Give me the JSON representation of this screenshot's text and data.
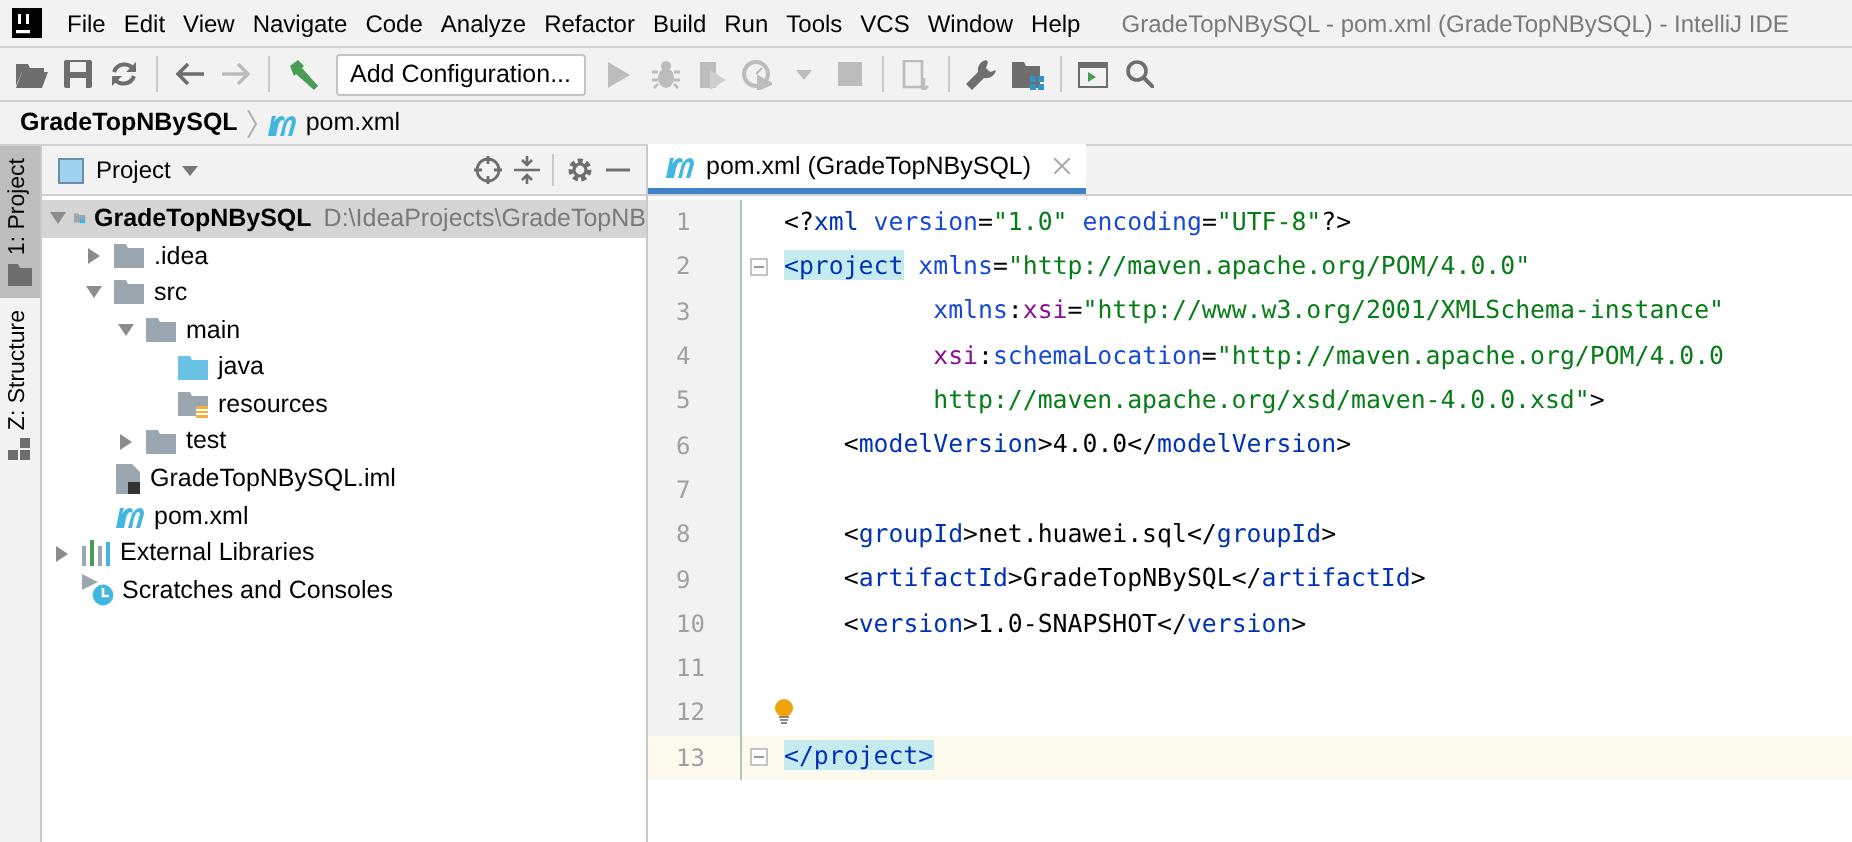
{
  "menu_bar": {
    "items": [
      "File",
      "Edit",
      "View",
      "Navigate",
      "Code",
      "Analyze",
      "Refactor",
      "Build",
      "Run",
      "Tools",
      "VCS",
      "Window",
      "Help"
    ],
    "window_title": "GradeTopNBySQL - pom.xml (GradeTopNBySQL) - IntelliJ IDE"
  },
  "toolbar": [
    {
      "kind": "open",
      "disabled": false
    },
    {
      "kind": "save",
      "disabled": false
    },
    {
      "kind": "sync",
      "disabled": false
    },
    {
      "kind": "sep"
    },
    {
      "kind": "back",
      "disabled": false
    },
    {
      "kind": "forward",
      "disabled": true
    },
    {
      "kind": "sep"
    },
    {
      "kind": "build",
      "disabled": false
    },
    {
      "kind": "config",
      "label": "Add Configuration..."
    },
    {
      "kind": "run",
      "disabled": true
    },
    {
      "kind": "debug",
      "disabled": true
    },
    {
      "kind": "coverage",
      "disabled": true
    },
    {
      "kind": "profile",
      "disabled": true
    },
    {
      "kind": "caret",
      "disabled": true
    },
    {
      "kind": "stop",
      "disabled": true
    },
    {
      "kind": "sep"
    },
    {
      "kind": "deploy",
      "disabled": true
    },
    {
      "kind": "sep"
    },
    {
      "kind": "wrench",
      "disabled": false
    },
    {
      "kind": "structure",
      "disabled": false
    },
    {
      "kind": "sep"
    },
    {
      "kind": "terminal",
      "disabled": false
    },
    {
      "kind": "search",
      "disabled": false
    }
  ],
  "breadcrumbs": [
    {
      "label": "GradeTopNBySQL",
      "kind": "module"
    },
    {
      "label": "pom.xml",
      "kind": "maven"
    }
  ],
  "side_stripe": [
    {
      "label": "1: Project",
      "kind": "folder",
      "selected": true
    },
    {
      "label": "Z: Structure",
      "kind": "structure",
      "selected": false
    }
  ],
  "project_panel": {
    "title": "Project",
    "tree": [
      {
        "name": "GradeTopNBySQL",
        "hint": "D:\\IdeaProjects\\GradeTopNB",
        "kind": "module",
        "expanded": true,
        "selected": true,
        "children": [
          {
            "name": ".idea",
            "kind": "folder",
            "expanded": false,
            "selected": false
          },
          {
            "name": "src",
            "kind": "folder",
            "expanded": true,
            "selected": false,
            "children": [
              {
                "name": "main",
                "kind": "folder",
                "expanded": true,
                "selected": false,
                "children": [
                  {
                    "name": "java",
                    "kind": "source",
                    "selected": false
                  },
                  {
                    "name": "resources",
                    "kind": "resources",
                    "selected": false
                  }
                ]
              },
              {
                "name": "test",
                "kind": "folder",
                "expanded": false,
                "selected": false
              }
            ]
          },
          {
            "name": "GradeTopNBySQL.iml",
            "kind": "iml",
            "selected": false
          },
          {
            "name": "pom.xml",
            "kind": "maven",
            "selected": false
          }
        ]
      },
      {
        "name": "External Libraries",
        "kind": "libraries",
        "expanded": false,
        "selected": false
      },
      {
        "name": "Scratches and Consoles",
        "kind": "scratches",
        "selected": false
      }
    ]
  },
  "editor": {
    "tabs": [
      {
        "label": "pom.xml (GradeTopNBySQL)",
        "selected": true
      }
    ],
    "lines": [
      {
        "number": "1",
        "current": false,
        "fold": false,
        "text": "<?xml version=\"1.0\" encoding=\"UTF-8\"?>"
      },
      {
        "number": "2",
        "current": false,
        "fold": true,
        "tag_matched": true,
        "text": "<project xmlns=\"http://maven.apache.org/POM/4.0.0\""
      },
      {
        "number": "3",
        "current": false,
        "fold": false,
        "text": "          xmlns:xsi=\"http://www.w3.org/2001/XMLSchema-instance\""
      },
      {
        "number": "4",
        "current": false,
        "fold": false,
        "text": "          xsi:schemaLocation=\"http://maven.apache.org/POM/4.0.0"
      },
      {
        "number": "5",
        "current": false,
        "fold": false,
        "text": "          http://maven.apache.org/xsd/maven-4.0.0.xsd\">"
      },
      {
        "number": "6",
        "current": false,
        "fold": false,
        "text": "    <modelVersion>4.0.0</modelVersion>"
      },
      {
        "number": "7",
        "current": false,
        "fold": false
      },
      {
        "number": "8",
        "current": false,
        "fold": false,
        "text": "    <groupId>net.huawei.sql</groupId>"
      },
      {
        "number": "9",
        "current": false,
        "fold": false,
        "text": "    <artifactId>GradeTopNBySQL</artifactId>"
      },
      {
        "number": "10",
        "current": false,
        "fold": false,
        "text": "    <version>1.0-SNAPSHOT</version>"
      },
      {
        "number": "11",
        "current": false,
        "fold": false
      },
      {
        "number": "12",
        "current": false,
        "fold": false,
        "bulb": true
      },
      {
        "number": "13",
        "current": true,
        "fold": true,
        "tag_matched": true,
        "text": "</project>"
      }
    ]
  }
}
